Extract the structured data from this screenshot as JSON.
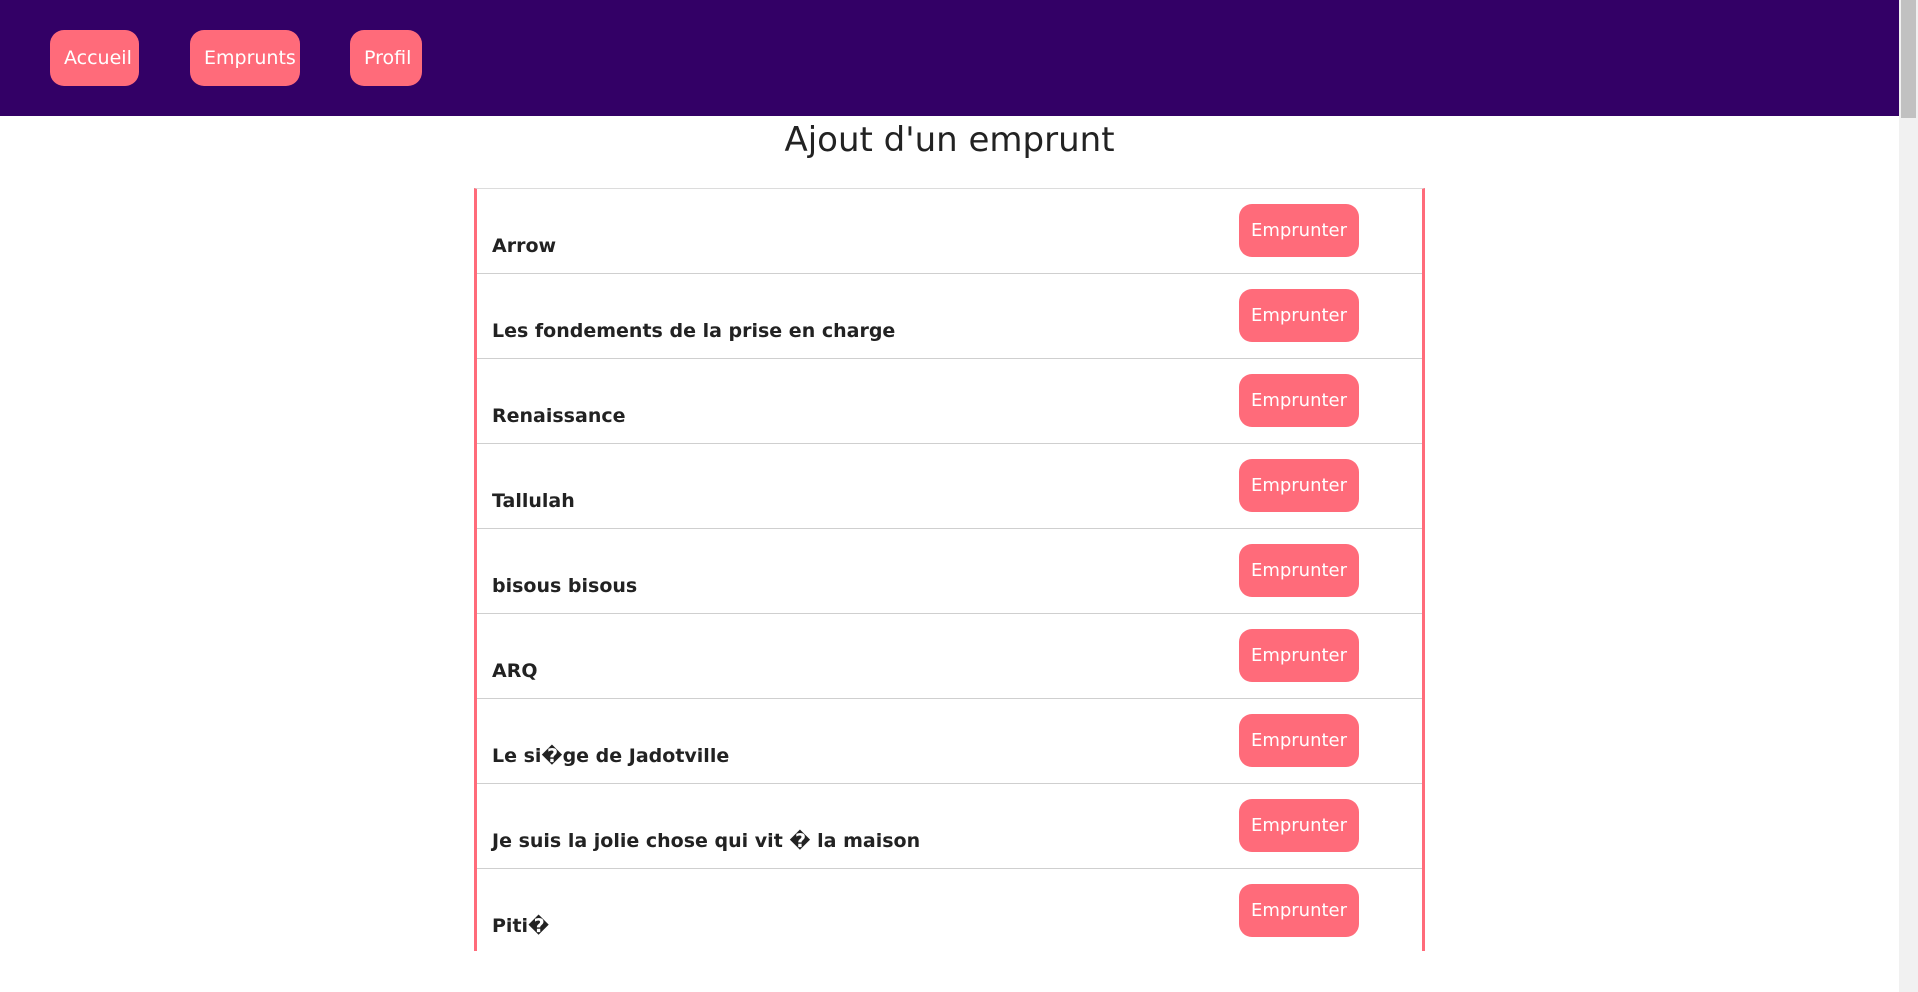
{
  "nav": {
    "items": [
      {
        "label": "Accueil"
      },
      {
        "label": "Emprunts"
      },
      {
        "label": "Profil"
      }
    ]
  },
  "page": {
    "title": "Ajout d'un emprunt"
  },
  "list": {
    "button_label": "Emprunter",
    "items": [
      {
        "title": "Arrow"
      },
      {
        "title": "Les fondements de la prise en charge"
      },
      {
        "title": "Renaissance"
      },
      {
        "title": "Tallulah"
      },
      {
        "title": "bisous bisous"
      },
      {
        "title": "ARQ"
      },
      {
        "title": "Le si�ge de Jadotville"
      },
      {
        "title": "Je suis la jolie chose qui vit � la maison"
      },
      {
        "title": "Piti�"
      }
    ]
  },
  "colors": {
    "navbar": "#330066",
    "accent": "#ff6b7a"
  }
}
